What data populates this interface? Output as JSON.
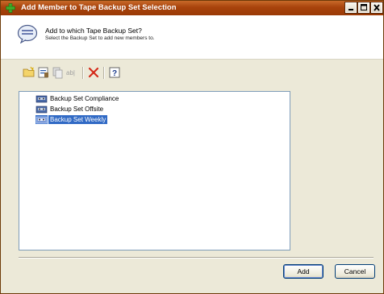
{
  "window": {
    "title": "Add Member to Tape Backup Set Selection",
    "title_icon": "green-plus-icon"
  },
  "header": {
    "icon": "speech-bubble-icon",
    "title": "Add to which Tape Backup Set?",
    "subtitle": "Select the Backup Set to add new members to."
  },
  "toolbar": {
    "buttons": [
      "new-folder-icon",
      "properties-icon",
      "copy-icon",
      "rename-icon",
      "delete-icon",
      "help-icon"
    ]
  },
  "list": {
    "items": [
      {
        "label": "Backup Set Compliance",
        "selected": false
      },
      {
        "label": "Backup Set Offsite",
        "selected": false
      },
      {
        "label": "Backup Set Weekly",
        "selected": true
      }
    ]
  },
  "buttons": {
    "add": "Add",
    "cancel": "Cancel"
  },
  "colors": {
    "titlebar": "#a8430c",
    "selection": "#316ac5",
    "face": "#ece9d8"
  }
}
